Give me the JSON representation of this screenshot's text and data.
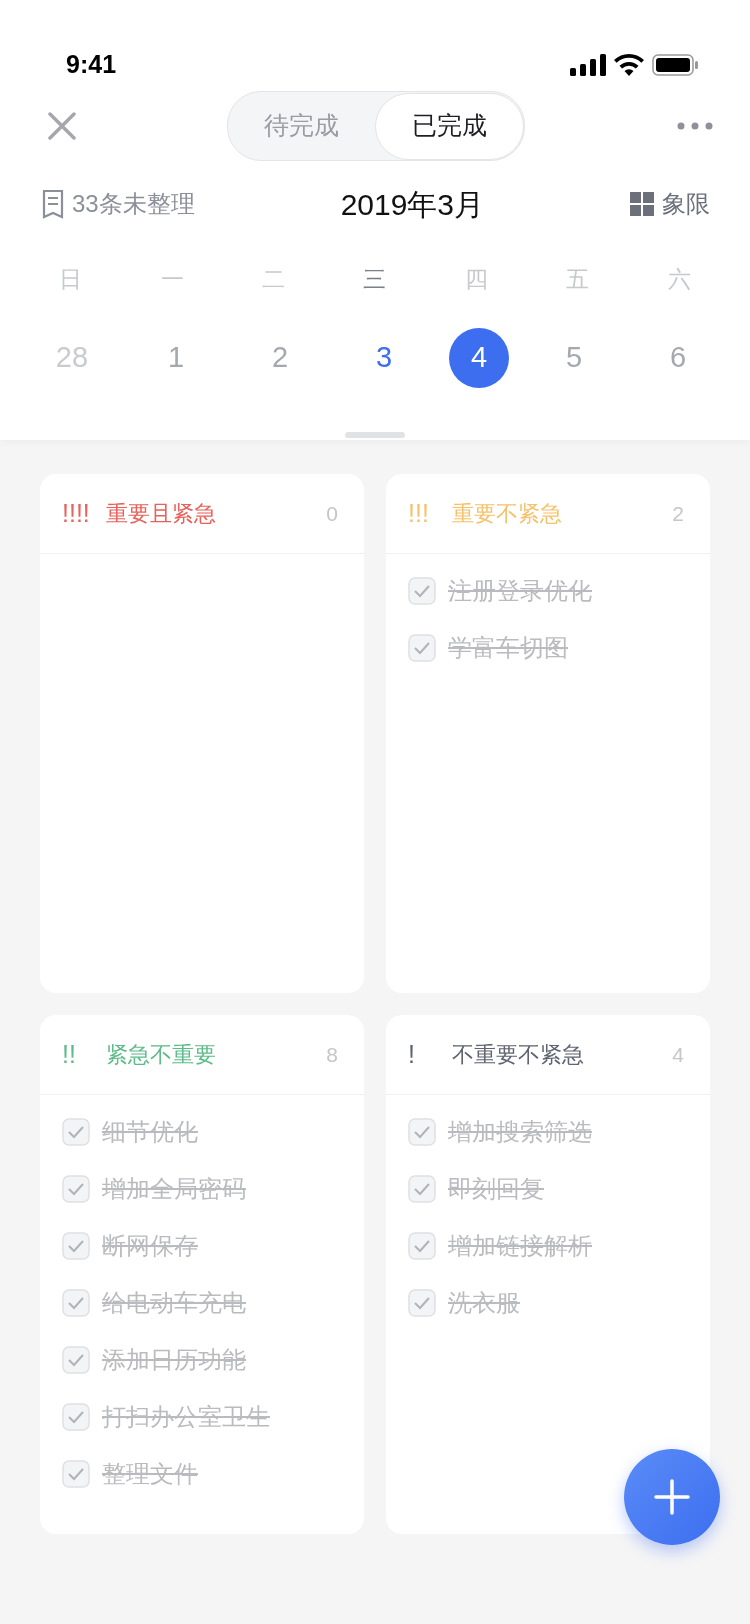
{
  "status_bar": {
    "time": "9:41"
  },
  "segments": [
    {
      "label": "待完成",
      "selected": false
    },
    {
      "label": "已完成",
      "selected": true
    }
  ],
  "toolbar": {
    "unsorted": "33条未整理",
    "month": "2019年3月",
    "view": "象限"
  },
  "weekdays": [
    {
      "label": "日",
      "current": false
    },
    {
      "label": "一",
      "current": false
    },
    {
      "label": "二",
      "current": false
    },
    {
      "label": "三",
      "current": true
    },
    {
      "label": "四",
      "current": false
    },
    {
      "label": "五",
      "current": false
    },
    {
      "label": "六",
      "current": false
    }
  ],
  "days": [
    {
      "label": "28",
      "kind": "other",
      "selected": false
    },
    {
      "label": "1",
      "kind": "normal",
      "selected": false
    },
    {
      "label": "2",
      "kind": "normal",
      "selected": false
    },
    {
      "label": "3",
      "kind": "today",
      "selected": false
    },
    {
      "label": "4",
      "kind": "normal",
      "selected": true
    },
    {
      "label": "5",
      "kind": "normal",
      "selected": false
    },
    {
      "label": "6",
      "kind": "normal",
      "selected": false
    }
  ],
  "quadrants": [
    {
      "marks": "!!!!",
      "title": "重要且紧急",
      "count": "0",
      "color": "#e8615a"
    },
    {
      "marks": "!!!",
      "title": "重要不紧急",
      "count": "2",
      "color": "#f5c26b",
      "tasks": [
        {
          "text": "注册登录优化",
          "checked": true
        },
        {
          "text": "学富车切图",
          "checked": true
        }
      ]
    },
    {
      "marks": "!!",
      "title": "紧急不重要",
      "count": "8",
      "color": "#5dbb8a",
      "tasks": [
        {
          "text": "细节优化",
          "checked": true
        },
        {
          "text": "增加全局密码",
          "checked": true
        },
        {
          "text": "断网保存",
          "checked": true
        },
        {
          "text": "给电动车充电",
          "checked": true
        },
        {
          "text": "添加日历功能",
          "checked": true
        },
        {
          "text": "打扫办公室卫生",
          "checked": true
        },
        {
          "text": "整理文件",
          "checked": true
        }
      ]
    },
    {
      "marks": "!",
      "title": "不重要不紧急",
      "count": "4",
      "color": "#5f6470",
      "tasks": [
        {
          "text": "增加搜索筛选",
          "checked": true
        },
        {
          "text": "即刻回复",
          "checked": true
        },
        {
          "text": "增加链接解析",
          "checked": true
        },
        {
          "text": "洗衣服",
          "checked": true
        }
      ]
    }
  ]
}
